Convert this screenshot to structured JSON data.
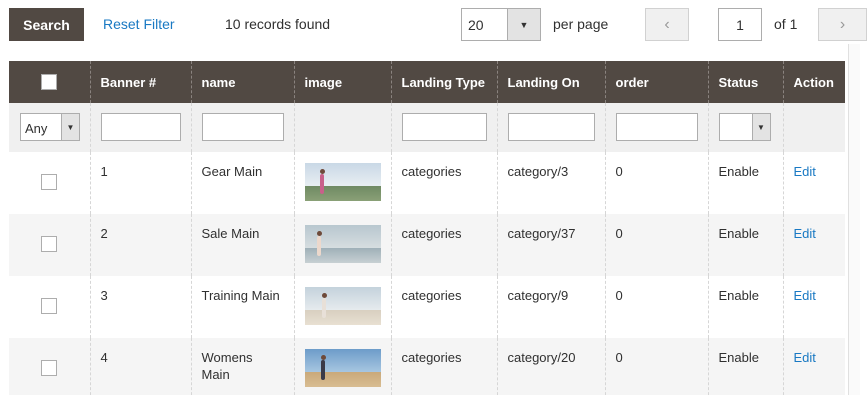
{
  "toolbar": {
    "search_label": "Search",
    "reset_label": "Reset Filter",
    "records_found": "10 records found",
    "per_page_value": "20",
    "per_page_label": "per page",
    "prev_glyph": "‹",
    "next_glyph": "›",
    "current_page": "1",
    "of_pages": "of 1"
  },
  "grid": {
    "columns": {
      "banner": "Banner #",
      "name": "name",
      "image": "image",
      "landing_type": "Landing Type",
      "landing_on": "Landing On",
      "order": "order",
      "status": "Status",
      "action": "Action"
    },
    "filters": {
      "any_label": "Any",
      "status_value": ""
    },
    "rows": [
      {
        "id": "1",
        "name": "Gear Main",
        "image": "gear-main-thumbnail",
        "landing_type": "categories",
        "landing_on": "category/3",
        "order": "0",
        "status": "Enable",
        "action": "Edit"
      },
      {
        "id": "2",
        "name": "Sale Main",
        "image": "sale-main-thumbnail",
        "landing_type": "categories",
        "landing_on": "category/37",
        "order": "0",
        "status": "Enable",
        "action": "Edit"
      },
      {
        "id": "3",
        "name": "Training Main",
        "image": "training-main-thumbnail",
        "landing_type": "categories",
        "landing_on": "category/9",
        "order": "0",
        "status": "Enable",
        "action": "Edit"
      },
      {
        "id": "4",
        "name": "Womens Main",
        "image": "womens-main-thumbnail",
        "landing_type": "categories",
        "landing_on": "category/20",
        "order": "0",
        "status": "Enable",
        "action": "Edit"
      }
    ]
  },
  "colors": {
    "header_bg": "#514943",
    "link": "#1979c3",
    "search_button": "#514943"
  }
}
